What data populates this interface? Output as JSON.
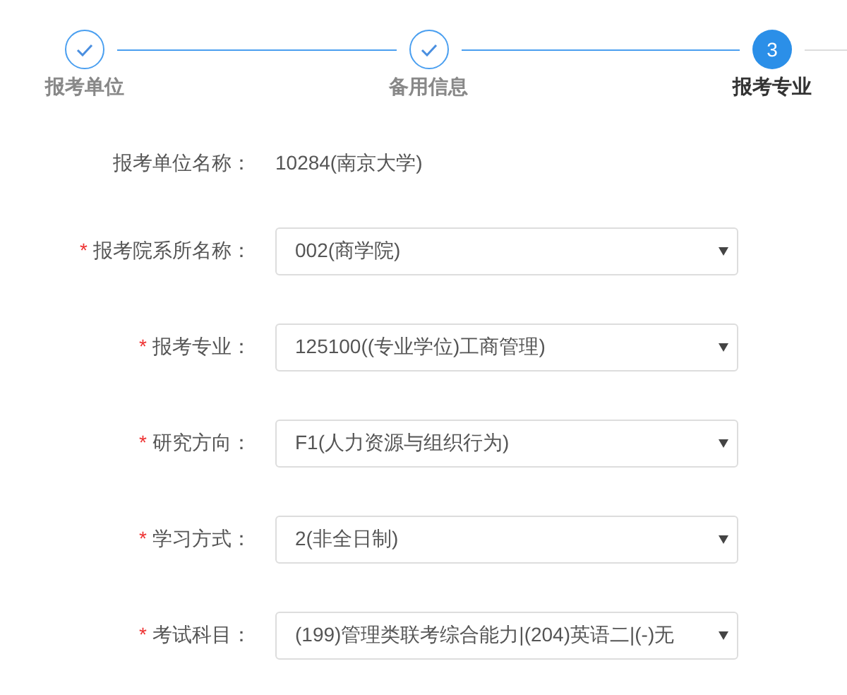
{
  "steps": [
    {
      "label": "报考单位",
      "done": true,
      "selected": false
    },
    {
      "label": "备用信息",
      "done": true,
      "selected": false
    },
    {
      "label": "报考专业",
      "done": false,
      "selected": true,
      "number": "3"
    }
  ],
  "form": {
    "rows": [
      {
        "kind": "static",
        "label": "报考单位名称：",
        "value": "10284(南京大学)"
      },
      {
        "kind": "select",
        "required_mark": "*",
        "label": "报考院系所名称：",
        "value": "002(商学院)"
      },
      {
        "kind": "select",
        "required_mark": "*",
        "label": "报考专业：",
        "value": "125100((专业学位)工商管理)"
      },
      {
        "kind": "select",
        "required_mark": "*",
        "label": "研究方向：",
        "value": "F1(人力资源与组织行为)"
      },
      {
        "kind": "select",
        "required_mark": "*",
        "label": "学习方式：",
        "value": "2(非全日制)"
      },
      {
        "kind": "select",
        "required_mark": "*",
        "label": "考试科目：",
        "value": "(199)管理类联考综合能力|(204)英语二|(-)无"
      }
    ]
  }
}
